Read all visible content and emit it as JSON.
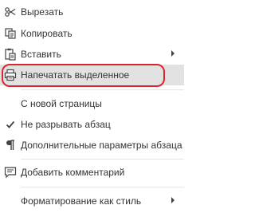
{
  "menu": {
    "items": [
      {
        "label": "Вырезать",
        "icon": "scissors-icon"
      },
      {
        "label": "Копировать",
        "icon": "copy-icon"
      },
      {
        "label": "Вставить",
        "icon": "paste-icon",
        "submenu": true
      },
      {
        "label": "Напечатать выделенное",
        "icon": "print-icon",
        "highlighted": true
      },
      {
        "label": "С новой страницы",
        "icon": ""
      },
      {
        "label": "Не разрывать абзац",
        "icon": "checkmark-icon",
        "checked": true
      },
      {
        "label": "Дополнительные параметры абзаца",
        "icon": "paragraph-icon"
      },
      {
        "label": "Добавить комментарий",
        "icon": "comment-icon"
      },
      {
        "label": "Форматирование как стиль",
        "icon": "",
        "submenu": true
      }
    ]
  },
  "colors": {
    "highlight_bg": "#e2e2e2",
    "annotation_ring": "#d9262e",
    "text": "#333333"
  }
}
